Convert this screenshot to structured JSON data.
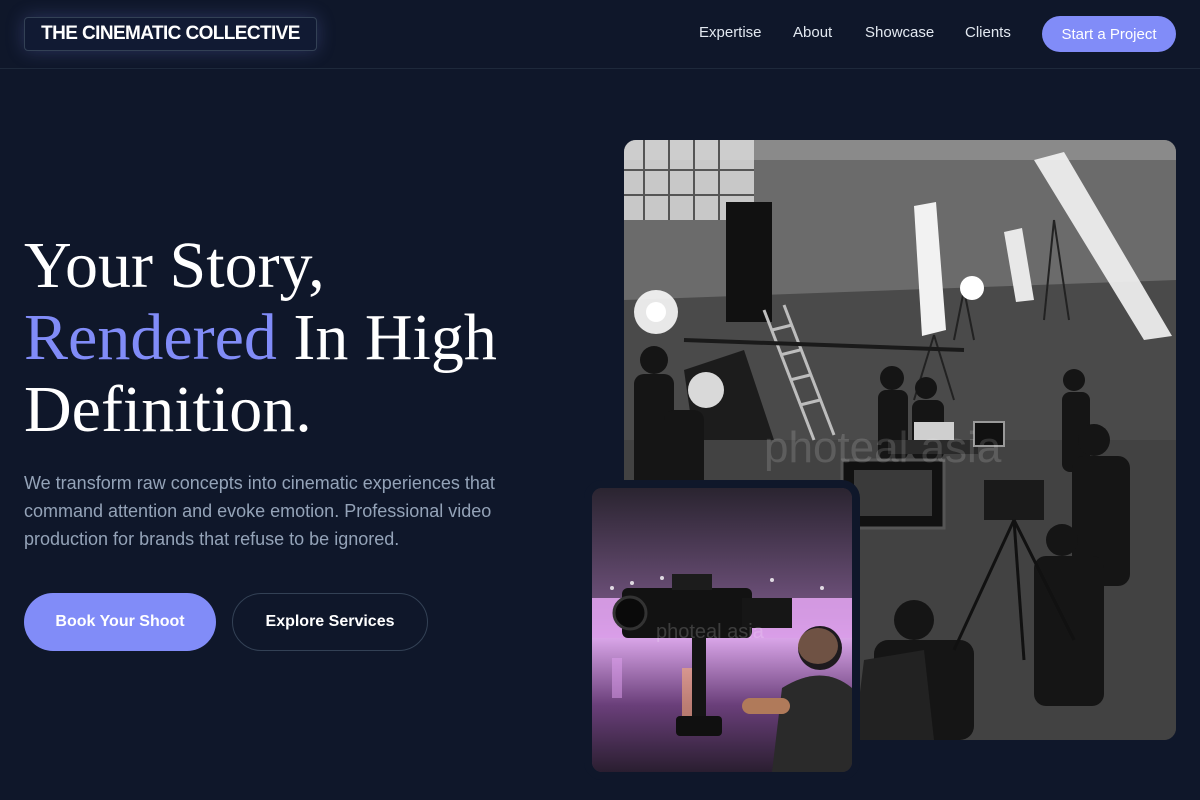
{
  "nav": {
    "logo": "THE CINEMATIC COLLECTIVE",
    "links": [
      "Expertise",
      "About",
      "Showcase",
      "Clients"
    ],
    "cta": "Start a Project"
  },
  "hero": {
    "title_line1": "Your Story,",
    "title_accent": "Rendered",
    "title_line2_rest": " In High",
    "title_line3": "Definition.",
    "description": "We transform raw concepts into cinematic experiences that command attention and evoke emotion. Professional video production for brands that refuse to be ignored.",
    "primary_button": "Book Your Shoot",
    "secondary_button": "Explore Services"
  },
  "colors": {
    "background": "#0f172a",
    "accent": "#818cf8",
    "muted_text": "#94a3b8"
  }
}
